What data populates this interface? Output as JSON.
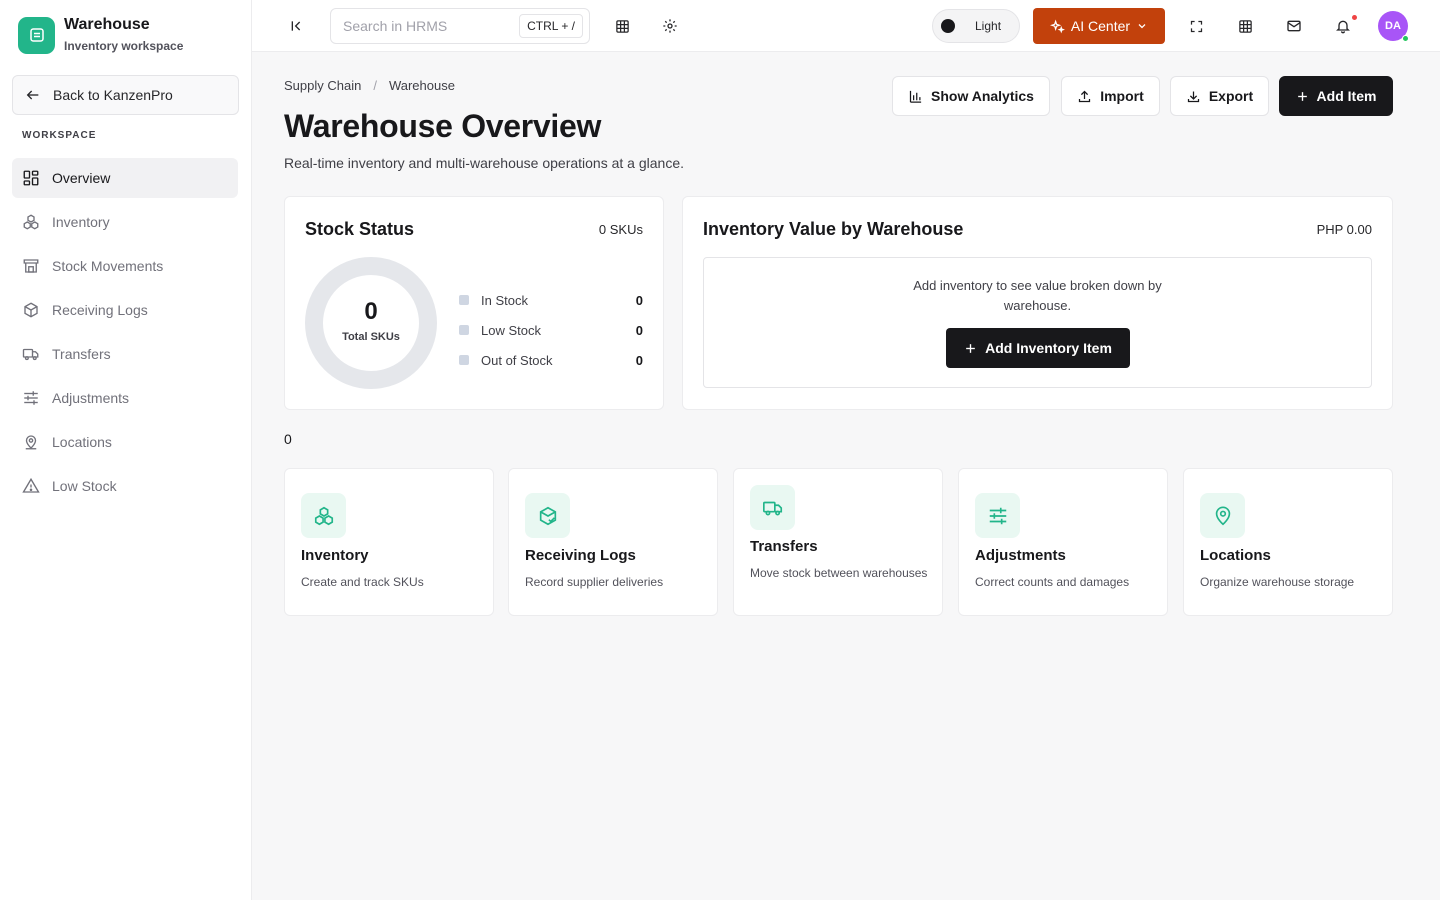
{
  "brand": {
    "title": "Warehouse",
    "subtitle": "Inventory workspace"
  },
  "sidebar": {
    "back_label": "Back to KanzenPro",
    "section_label": "WORKSPACE",
    "items": [
      {
        "label": "Overview",
        "icon": "grid-icon",
        "active": true
      },
      {
        "label": "Inventory",
        "icon": "boxes-icon"
      },
      {
        "label": "Stock Movements",
        "icon": "store-icon"
      },
      {
        "label": "Receiving Logs",
        "icon": "package-check-icon"
      },
      {
        "label": "Transfers",
        "icon": "truck-icon"
      },
      {
        "label": "Adjustments",
        "icon": "sliders-icon"
      },
      {
        "label": "Locations",
        "icon": "map-pin-icon"
      },
      {
        "label": "Low Stock",
        "icon": "warning-icon"
      }
    ]
  },
  "topbar": {
    "search_placeholder": "Search in HRMS",
    "search_shortcut": "CTRL + /",
    "theme_label": "Light",
    "ai_label": "AI Center",
    "avatar_initials": "DA"
  },
  "breadcrumb": [
    "Supply Chain",
    "Warehouse"
  ],
  "header": {
    "title": "Warehouse Overview",
    "subtitle": "Real-time inventory and multi-warehouse operations at a glance.",
    "actions": {
      "analytics": "Show Analytics",
      "import": "Import",
      "export": "Export",
      "add": "Add Item"
    }
  },
  "stock_status": {
    "title": "Stock Status",
    "sku_count": "0 SKUs",
    "total": "0",
    "total_label": "Total SKUs",
    "legend": [
      {
        "label": "In Stock",
        "value": "0"
      },
      {
        "label": "Low Stock",
        "value": "0"
      },
      {
        "label": "Out of Stock",
        "value": "0"
      }
    ]
  },
  "inventory_value": {
    "title": "Inventory Value by Warehouse",
    "total": "PHP 0.00",
    "empty_text": "Add inventory to see value broken down by warehouse.",
    "empty_button": "Add Inventory Item"
  },
  "stray_value": "0",
  "quick_links": [
    {
      "title": "Inventory",
      "desc": "Create and track SKUs",
      "icon": "boxes-icon"
    },
    {
      "title": "Receiving Logs",
      "desc": "Record supplier deliveries",
      "icon": "package-check-icon"
    },
    {
      "title": "Transfers",
      "desc": "Move stock between warehouses",
      "icon": "truck-icon"
    },
    {
      "title": "Adjustments",
      "desc": "Correct counts and damages",
      "icon": "sliders-icon"
    },
    {
      "title": "Locations",
      "desc": "Organize warehouse storage",
      "icon": "map-pin-icon"
    }
  ],
  "colors": {
    "accent": "#22b58a",
    "ai_button": "#c2410c",
    "dark_button": "#18181b",
    "avatar": "#a855f7"
  }
}
